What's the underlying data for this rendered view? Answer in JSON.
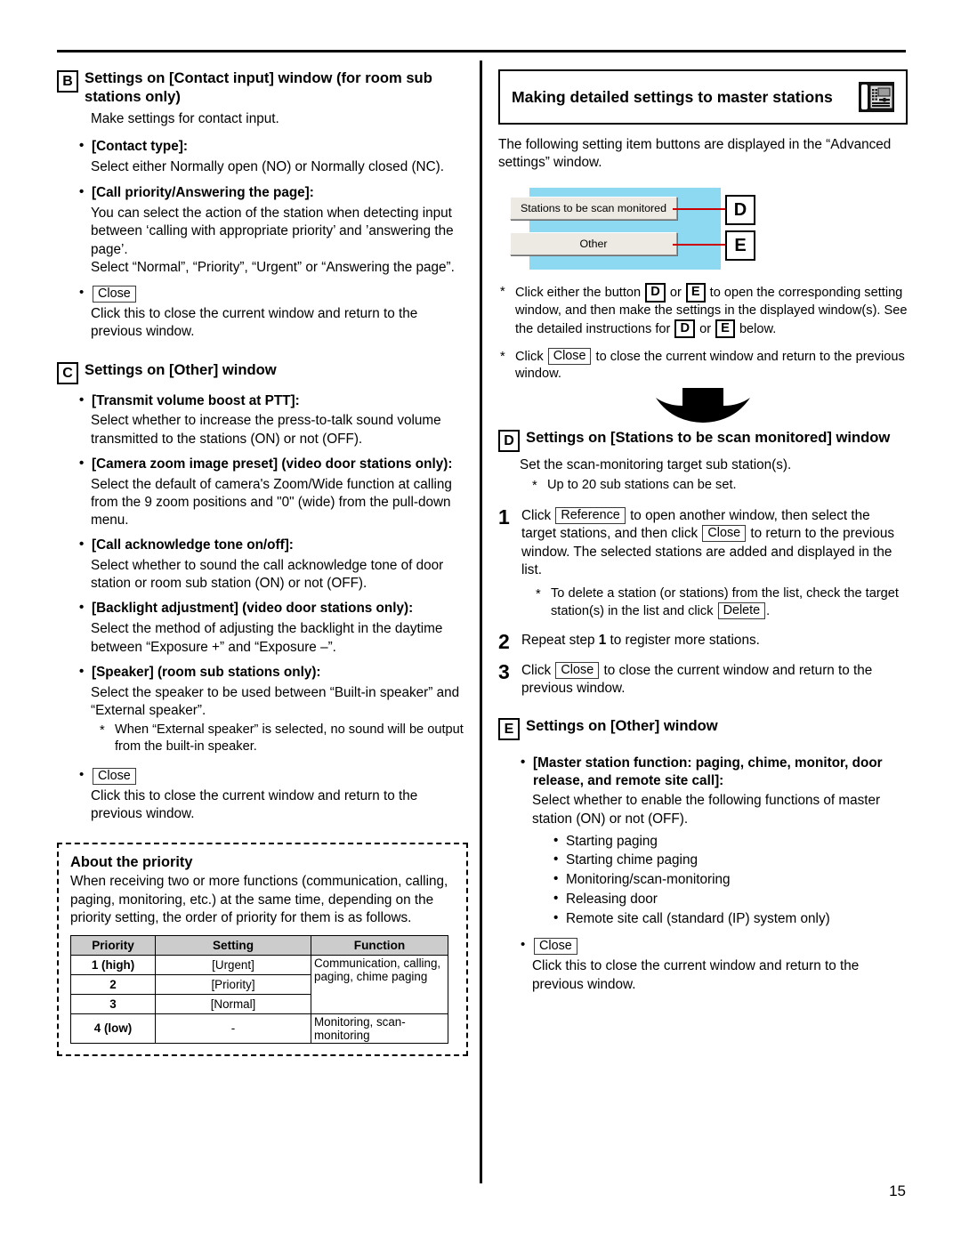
{
  "page": {
    "number": "15"
  },
  "left": {
    "section_b": {
      "letter": "B",
      "title": "Settings on [Contact input] window (for room sub stations only)",
      "intro": "Make settings for contact input.",
      "items": [
        {
          "label": "[Contact type]:",
          "desc": "Select either Normally open (NO) or Normally closed (NC)."
        },
        {
          "label": "[Call priority/Answering the page]:",
          "desc": "You can select the action of the station when detecting input between ‘calling with appropriate priority’ and ’answering the page’.",
          "desc2": "Select “Normal”, “Priority”, “Urgent” or “Answering the page”."
        }
      ],
      "close_key": "Close",
      "close_desc": "Click this to close the current window and return to the previous window."
    },
    "section_c": {
      "letter": "C",
      "title": "Settings on [Other] window",
      "items": [
        {
          "label": "[Transmit volume boost at PTT]:",
          "desc": "Select whether to increase the press-to-talk sound volume transmitted to the stations (ON) or not (OFF)."
        },
        {
          "label": "[Camera zoom image preset] (video door stations only):",
          "desc": "Select the default of camera's Zoom/Wide function at calling from the 9 zoom positions and \"0\" (wide) from the pull-down menu."
        },
        {
          "label": "[Call acknowledge tone on/off]:",
          "desc": "Select whether to sound the call acknowledge tone of door station or room sub station (ON) or not (OFF)."
        },
        {
          "label": "[Backlight adjustment] (video door stations only):",
          "desc": "Select the method of adjusting the backlight in the daytime between “Exposure +” and “Exposure –”."
        },
        {
          "label": "[Speaker] (room sub stations only):",
          "desc": "Select the speaker to be used between “Built-in speaker” and “External speaker”.",
          "note": "When “External speaker” is selected, no sound will be output from the built-in speaker."
        }
      ],
      "close_key": "Close",
      "close_desc": "Click this to close the current window and return to the previous window."
    },
    "priority_box": {
      "title": "About the priority",
      "intro": "When receiving two or more functions (communication, calling, paging, monitoring, etc.) at the same time, depending on the priority setting, the order of priority for them is as follows.",
      "table": {
        "headers": [
          "Priority",
          "Setting",
          "Function"
        ],
        "rows": [
          {
            "priority": "1 (high)",
            "setting": "[Urgent]"
          },
          {
            "priority": "2",
            "setting": "[Priority]"
          },
          {
            "priority": "3",
            "setting": "[Normal]"
          },
          {
            "priority": "4 (low)",
            "setting": "-"
          }
        ],
        "function_span_1_3": "Communication, calling, paging, chime paging",
        "function_row_4": "Monitoring, scan-monitoring"
      }
    }
  },
  "right": {
    "banner": {
      "title": "Making detailed settings to master stations",
      "icon": "desk-phone-icon"
    },
    "intro": "The following setting item buttons are displayed in the “Advanced settings” window.",
    "figure": {
      "button_1": "Stations to be scan monitored",
      "button_2": "Other",
      "marker_1": "D",
      "marker_2": "E",
      "panel_color": "#8ed9f2",
      "leader_color": "#cc0000"
    },
    "notes": [
      {
        "part1": "Click either the button",
        "key1": "D",
        "mid1": "or",
        "key2": "E",
        "part2": "to open the corresponding setting window, and then make the settings in the displayed window(s). See the detailed instructions for",
        "key3": "D",
        "mid2": "or",
        "key4": "E",
        "part3": "below."
      },
      {
        "part1": "Click",
        "key1": "Close",
        "part2": "to close the current window and return to the previous window."
      }
    ],
    "section_d": {
      "letter": "D",
      "title": "Settings on [Stations to be scan monitored] window",
      "intro": "Set the scan-monitoring target sub station(s).",
      "note": "Up to 20 sub stations can be set.",
      "steps": [
        {
          "num": "1",
          "t1": "Click",
          "key1": "Reference",
          "t2": "to open another window, then select the target stations, and then click",
          "key2": "Close",
          "t3": "to return to the previous window.",
          "t4": "The selected stations are added and displayed in the list.",
          "note_t1": "To delete a station (or stations) from the list, check the target station(s) in the list and click",
          "note_key": "Delete",
          "note_t2": "."
        },
        {
          "num": "2",
          "t1": "Repeat step",
          "bold_ref": "1",
          "t2": "to register more stations."
        },
        {
          "num": "3",
          "t1": "Click",
          "key1": "Close",
          "t2": "to close the current window and return to the previous window."
        }
      ]
    },
    "section_e": {
      "letter": "E",
      "title": "Settings on [Other] window",
      "item": {
        "label": "[Master station function: paging, chime, monitor, door release, and remote site call]:",
        "desc": "Select whether to enable the following functions of master station (ON) or not (OFF).",
        "functions": [
          "Starting paging",
          "Starting chime paging",
          "Monitoring/scan-monitoring",
          "Releasing door",
          "Remote site call (standard (IP) system only)"
        ]
      },
      "close_key": "Close",
      "close_desc": "Click this to close the current window and return to the previous window."
    }
  }
}
